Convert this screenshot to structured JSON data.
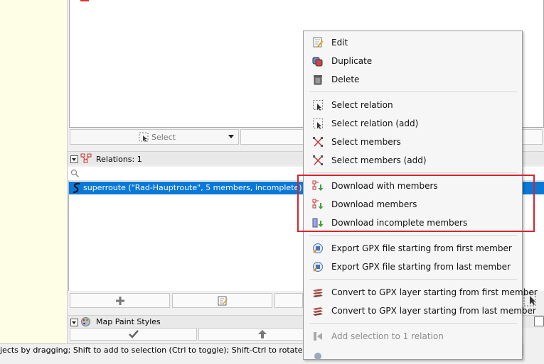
{
  "selection_panel": {
    "select_button_label": "Select"
  },
  "relations_panel": {
    "title": "Relations: 1",
    "search_placeholder": "",
    "rows": [
      {
        "label": "superroute (\"Rad-Hauptroute\", 5 members, incomplete)",
        "selected": true
      }
    ]
  },
  "map_paint_styles": {
    "title": "Map Paint Styles"
  },
  "status_bar": {
    "text": "jects by dragging; Shift to add to selection (Ctrl to toggle); Shift-Ctrl to rotate selected;"
  },
  "context_menu": {
    "items": [
      {
        "label": "Edit",
        "icon": "edit-icon",
        "enabled": true
      },
      {
        "label": "Duplicate",
        "icon": "duplicate-icon",
        "enabled": true
      },
      {
        "label": "Delete",
        "icon": "trash-icon",
        "enabled": true
      },
      {
        "label": "Select relation",
        "icon": "select-relation-icon",
        "enabled": true
      },
      {
        "label": "Select relation (add)",
        "icon": "select-relation-add-icon",
        "enabled": true
      },
      {
        "label": "Select members",
        "icon": "select-members-icon",
        "enabled": true
      },
      {
        "label": "Select members (add)",
        "icon": "select-members-add-icon",
        "enabled": true
      },
      {
        "label": "Download with members",
        "icon": "download-with-members-icon",
        "enabled": true
      },
      {
        "label": "Download members",
        "icon": "download-members-icon",
        "enabled": true
      },
      {
        "label": "Download incomplete members",
        "icon": "download-incomplete-icon",
        "enabled": true
      },
      {
        "label": "Export GPX file starting from first member",
        "icon": "gpx-export-icon",
        "enabled": true
      },
      {
        "label": "Export GPX file starting from last member",
        "icon": "gpx-export-icon",
        "enabled": true
      },
      {
        "label": "Convert to GPX layer starting from first member",
        "icon": "gpx-layer-icon",
        "enabled": true
      },
      {
        "label": "Convert to GPX layer starting from last member",
        "icon": "gpx-layer-icon",
        "enabled": true
      },
      {
        "label": "Add selection to 1 relation",
        "icon": "add-selection-icon",
        "enabled": false
      },
      {
        "label": "",
        "icon": "more-icon",
        "enabled": true
      }
    ]
  },
  "colors": {
    "selection_blue": "#0a78d7",
    "highlight_red": "#d9232d",
    "map_background": "#fefee6"
  }
}
